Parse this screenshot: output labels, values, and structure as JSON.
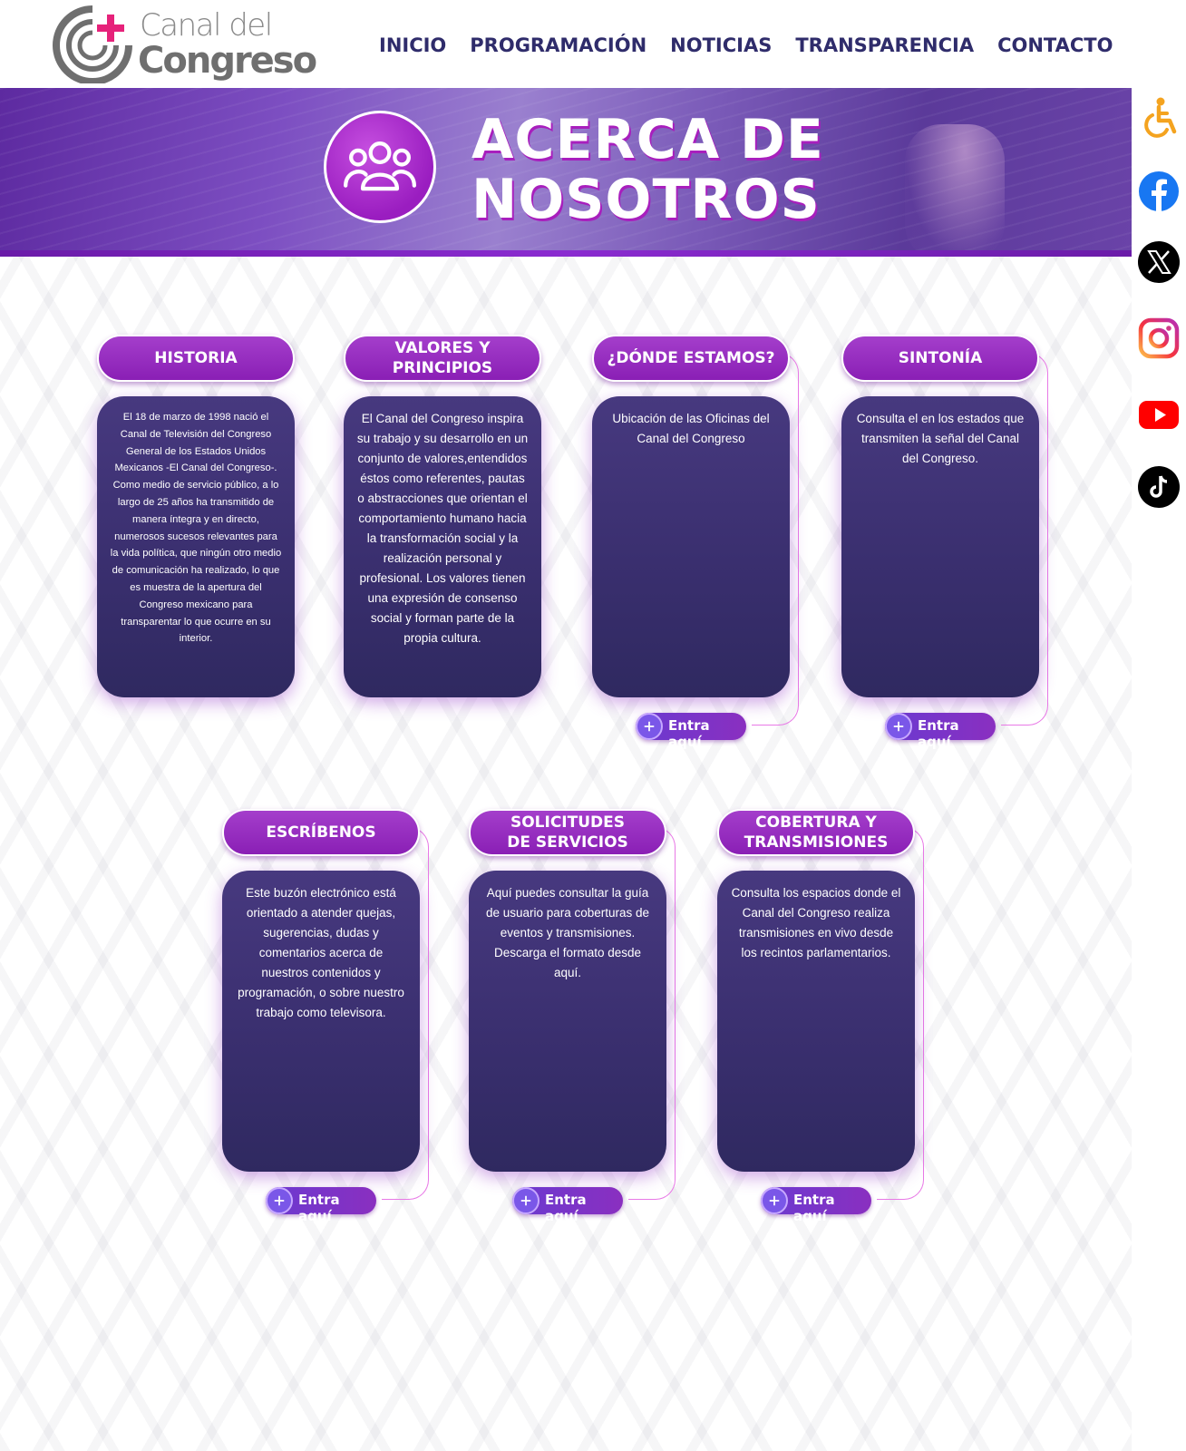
{
  "logo": {
    "line1": "Canal del",
    "line2": "Congreso"
  },
  "nav": [
    {
      "label": "INICIO"
    },
    {
      "label": "PROGRAMACIÓN"
    },
    {
      "label": "NOTICIAS"
    },
    {
      "label": "TRANSPARENCIA"
    },
    {
      "label": "CONTACTO"
    }
  ],
  "banner": {
    "title_line1": "ACERCA DE",
    "title_line2": "NOSOTROS",
    "icon": "people-group-icon"
  },
  "social": [
    {
      "icon": "accessibility-icon",
      "color": "#f4a31f"
    },
    {
      "icon": "facebook-icon",
      "color": "#1877f2"
    },
    {
      "icon": "x-icon",
      "color": "#000000"
    },
    {
      "icon": "instagram-icon",
      "color": "#e4405f"
    },
    {
      "icon": "youtube-icon",
      "color": "#ff0000"
    },
    {
      "icon": "tiktok-icon",
      "color": "#000000"
    }
  ],
  "cards": [
    {
      "title": "HISTORIA",
      "text": "El 18 de marzo de 1998 nació el Canal de Televisión del Congreso General de los Estados Unidos Mexicanos -El Canal del Congreso-. Como medio de servicio público, a lo largo de 25 años ha transmitido de manera íntegra y en directo, numerosos sucesos relevantes para la vida política, que ningún otro medio de comunicación ha realizado, lo que es muestra de la apertura del Congreso mexicano para transparentar lo que ocurre en su interior."
    },
    {
      "title": "VALORES Y\nPRINCIPIOS",
      "text": "El Canal del Congreso inspira su trabajo y su desarrollo en un conjunto de valores,entendidos éstos como referentes, pautas o abstracciones que orientan el comportamiento humano hacia la transformación social y la realización personal y profesional. Los valores tienen una expresión de consenso social y forman parte de la propia cultura."
    },
    {
      "title": "¿DÓNDE ESTAMOS?",
      "text": "Ubicación de las Oficinas del Canal del Congreso",
      "button": "Entra aquí"
    },
    {
      "title": "SINTONÍA",
      "text": "Consulta el en los estados que transmiten la señal del Canal del Congreso.",
      "button": "Entra aquí"
    },
    {
      "title": "ESCRÍBENOS",
      "text": "Este buzón electrónico está orientado a atender quejas, sugerencias, dudas y comentarios acerca de nuestros contenidos y programación, o sobre nuestro trabajo como televisora.",
      "button": "Entra aquí"
    },
    {
      "title": "SOLICITUDES\nDE SERVICIOS",
      "text": "Aquí puedes consultar la guía de usuario para coberturas de eventos y transmisiones. Descarga el formato  desde aquí.",
      "button": "Entra aquí"
    },
    {
      "title": "COBERTURA Y\nTRANSMISIONES",
      "text": "Consulta los espacios donde el Canal del Congreso realiza transmisiones en vivo desde los recintos parlamentarios.",
      "button": "Entra aquí"
    }
  ]
}
